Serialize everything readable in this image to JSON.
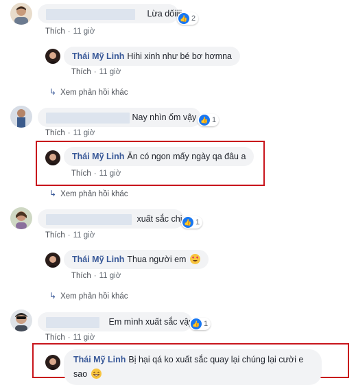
{
  "colors": {
    "highlight": "#c8141b",
    "name_link": "#385898",
    "bubble": "#f2f3f5",
    "like_blue": "#1877f2"
  },
  "comments": [
    {
      "text": "Lừa dốiiii",
      "reaction_count": "2",
      "actions": {
        "like": "Thích",
        "time": "11 giờ"
      },
      "reply": {
        "author": "Thái Mỹ Linh",
        "text": "Hihi xinh như bé bơ hơmna",
        "actions": {
          "like": "Thích",
          "time": "11 giờ"
        }
      },
      "more_replies": "Xem phản hồi khác"
    },
    {
      "text": "Nay nhìn ốm vậy",
      "reaction_count": "1",
      "actions": {
        "like": "Thích",
        "time": "11 giờ"
      },
      "reply": {
        "author": "Thái Mỹ Linh",
        "text": "Ăn có ngon mấy ngày qa đâu a",
        "actions": {
          "like": "Thích",
          "time": "11 giờ"
        }
      },
      "more_replies": "Xem phản hồi khác"
    },
    {
      "text": "xuất sắc chị",
      "reaction_count": "1",
      "actions": {
        "like": "Thích",
        "time": "11 giờ"
      },
      "reply": {
        "author": "Thái Mỹ Linh",
        "text": "Thua người em",
        "emoji": "heart-eyes-emoji",
        "actions": {
          "like": "Thích",
          "time": "11 giờ"
        }
      },
      "more_replies": "Xem phản hồi khác"
    },
    {
      "text": "Em mình xuất sắc vậy",
      "reaction_count": "1",
      "actions": {
        "like": "Thích",
        "time": "11 giờ"
      },
      "reply": {
        "author": "Thái Mỹ Linh",
        "text": "Bị hại qá ko xuất sắc quay lại chúng lại cười e sao",
        "emoji": "grinning-emoji"
      }
    }
  ]
}
